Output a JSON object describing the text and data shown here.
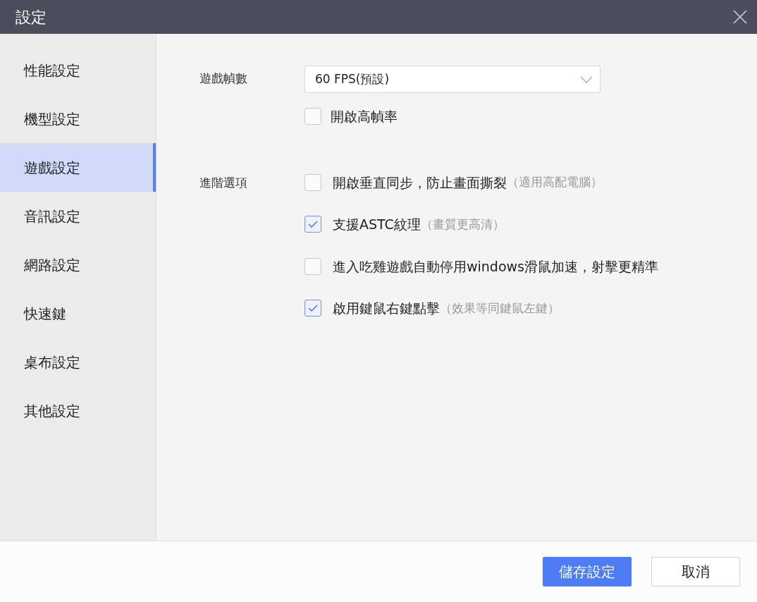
{
  "window": {
    "title": "設定"
  },
  "sidebar": {
    "items": [
      {
        "label": "性能設定",
        "selected": false
      },
      {
        "label": "機型設定",
        "selected": false
      },
      {
        "label": "遊戲設定",
        "selected": true
      },
      {
        "label": "音訊設定",
        "selected": false
      },
      {
        "label": "網路設定",
        "selected": false
      },
      {
        "label": "快速鍵",
        "selected": false
      },
      {
        "label": "桌布設定",
        "selected": false
      },
      {
        "label": "其他設定",
        "selected": false
      }
    ]
  },
  "frame_rate": {
    "label": "遊戲幀數",
    "select": {
      "value": "60 FPS(預設)"
    },
    "high_fps": {
      "label": "開啟高幀率",
      "checked": false
    }
  },
  "advanced": {
    "label": "進階選項",
    "options": [
      {
        "label": "開啟垂直同步，防止畫面撕裂",
        "note": "（適用高配電腦）",
        "checked": false
      },
      {
        "label": "支援ASTC紋理",
        "note": "（畫質更高清）",
        "checked": true
      },
      {
        "label": "進入吃雞遊戲自動停用windows滑鼠加速，射擊更精準",
        "checked": false
      },
      {
        "label": "啟用鍵鼠右鍵點擊",
        "note": "（效果等同鍵鼠左鍵）",
        "checked": true
      }
    ]
  },
  "buttons": [
    {
      "label": "儲存設定",
      "kind": "primary"
    },
    {
      "label": "取消",
      "kind": "secondary"
    }
  ]
}
